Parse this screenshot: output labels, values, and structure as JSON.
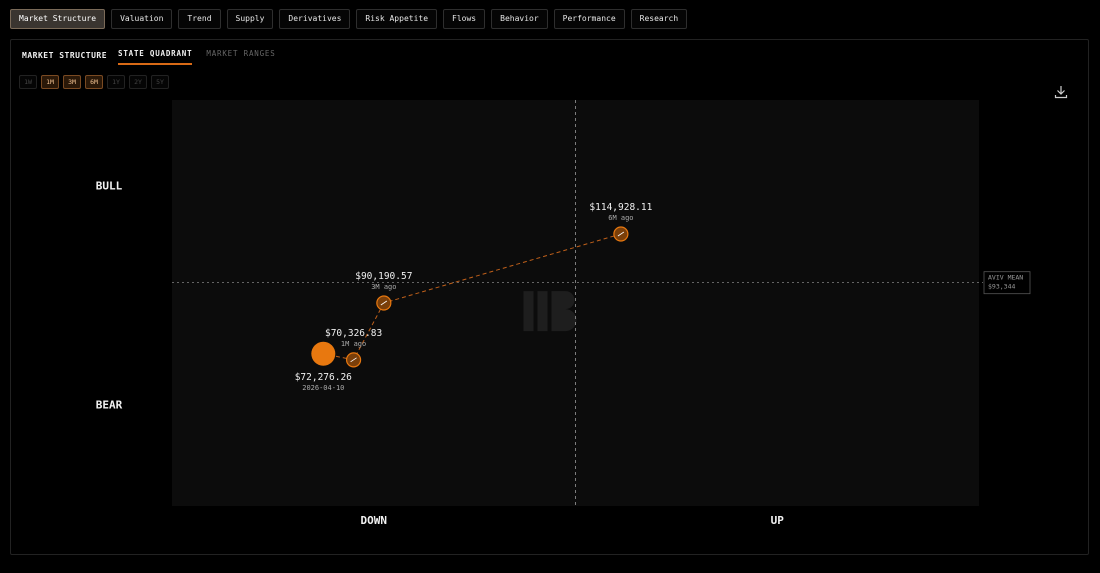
{
  "nav": [
    {
      "label": "Market Structure",
      "active": true
    },
    {
      "label": "Valuation",
      "active": false
    },
    {
      "label": "Trend",
      "active": false
    },
    {
      "label": "Supply",
      "active": false
    },
    {
      "label": "Derivatives",
      "active": false
    },
    {
      "label": "Risk Appetite",
      "active": false
    },
    {
      "label": "Flows",
      "active": false
    },
    {
      "label": "Behavior",
      "active": false
    },
    {
      "label": "Performance",
      "active": false
    },
    {
      "label": "Research",
      "active": false
    }
  ],
  "panel": {
    "title": "MARKET STRUCTURE",
    "tabs": [
      {
        "label": "STATE QUADRANT",
        "active": true
      },
      {
        "label": "MARKET RANGES",
        "active": false
      }
    ],
    "ranges": [
      {
        "label": "1W",
        "on": false
      },
      {
        "label": "1M",
        "on": true
      },
      {
        "label": "3M",
        "on": true
      },
      {
        "label": "6M",
        "on": true
      },
      {
        "label": "1Y",
        "on": false
      },
      {
        "label": "2Y",
        "on": false
      },
      {
        "label": "5Y",
        "on": false
      }
    ]
  },
  "chart_data": {
    "type": "scatter",
    "quadrant_labels": {
      "top": "BULL",
      "bottom": "BEAR",
      "left": "DOWN",
      "right": "UP"
    },
    "mean_line": {
      "label": "AVIV MEAN",
      "value": "$93,344"
    },
    "points": [
      {
        "price": "$114,928.11",
        "sub": "6M ago",
        "x": 0.045,
        "y": 0.12,
        "current": false
      },
      {
        "price": "$90,190.57",
        "sub": "3M ago",
        "x": -0.19,
        "y": -0.05,
        "current": false
      },
      {
        "price": "$70,326.83",
        "sub": "1M ago",
        "x": -0.22,
        "y": -0.19,
        "current": false
      },
      {
        "price": "$72,276.26",
        "sub": "2026-04-10",
        "x": -0.25,
        "y": -0.175,
        "current": true
      }
    ],
    "x_range": [
      -0.4,
      0.4
    ],
    "y_range": [
      -0.55,
      0.45
    ],
    "colors": {
      "accent": "#e8780f",
      "trail": "#c0601a",
      "grid": "#9a9a9a"
    }
  }
}
